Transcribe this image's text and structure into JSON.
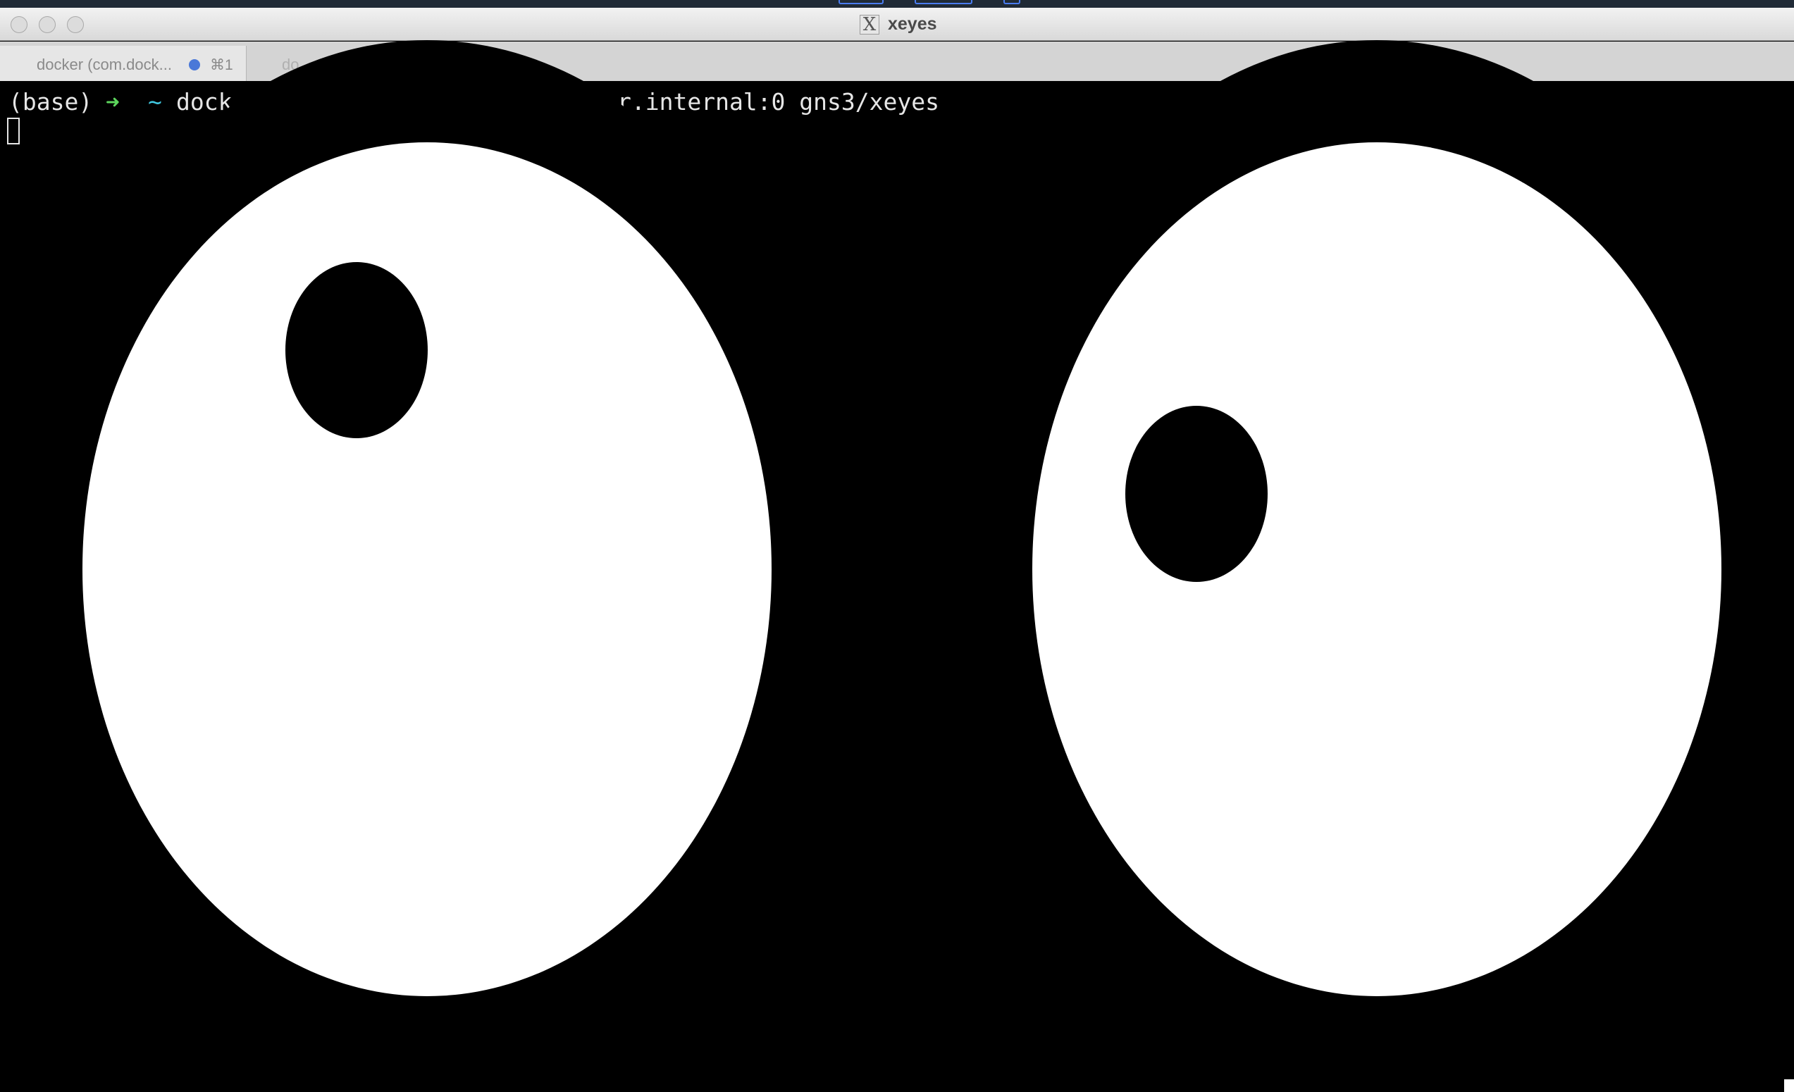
{
  "window": {
    "title": "xeyes",
    "title_icon": "x-window-icon"
  },
  "terminal_tabs": [
    {
      "label": "docker (com.dock...",
      "shortcut": "⌘1",
      "activity_dot_color": "#4a78d8"
    },
    {
      "label": "do"
    }
  ],
  "terminal": {
    "prompt_env": "(base)",
    "prompt_arrow": "➜",
    "prompt_dir": "~",
    "command_visible_start": "dock",
    "command_visible_end": "r.internal:0 gns3/xeyes"
  },
  "colors": {
    "eye_white": "#ffffff",
    "pupil": "#000000",
    "background": "#000000",
    "prompt_arrow": "#5dd65d",
    "prompt_dir": "#40c8e0"
  }
}
